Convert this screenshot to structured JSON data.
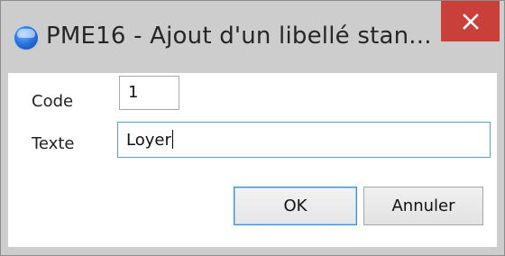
{
  "window": {
    "title": "PME16 - Ajout d'un libellé stan...",
    "close_glyph": "×"
  },
  "form": {
    "code_label": "Code",
    "code_value": "1",
    "texte_label": "Texte",
    "texte_value": "Loyer"
  },
  "buttons": {
    "ok_label": "OK",
    "cancel_label": "Annuler"
  },
  "icons": {
    "app": "app-sphere-icon",
    "close": "close-icon"
  },
  "colors": {
    "close_button": "#c9403a",
    "focus_border": "#3c8fd8",
    "title_bar": "#cdcdcd"
  }
}
